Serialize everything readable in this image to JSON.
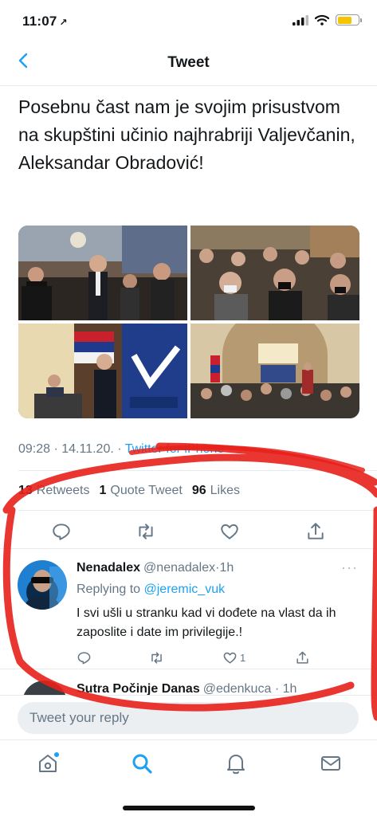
{
  "status_bar": {
    "time": "11:07",
    "location_arrow": "↗"
  },
  "nav": {
    "title": "Tweet",
    "back_icon": "chevron-left-icon"
  },
  "tweet": {
    "text": "Posebnu čast nam je svojim prisustvom na skupštini učinio najhrabriji Valjevčanin, Aleksandar Obradović!",
    "photos": [
      "conference-audience-photo",
      "audience-masks-photo",
      "speaker-podium-photo",
      "hall-audience-photo"
    ],
    "timestamp": "09:28 · 14.11.20.",
    "source_sep": " · ",
    "source": "Twitter for iPhone",
    "stats": {
      "retweets_count": "13",
      "retweets_label": "Retweets",
      "quotes_count": "1",
      "quotes_label": "Quote Tweet",
      "likes_count": "96",
      "likes_label": "Likes"
    }
  },
  "reply": {
    "name": "Nenadalex",
    "handle": "@nenadalex",
    "sep": "·",
    "time": "1h",
    "more": "···",
    "replying_label": "Replying to",
    "replying_handle": "@jeremic_vuk",
    "text": "I svi ušli u stranku kad vi dođete na vlast da ih zaposlite i date im privilegije.!",
    "like_count": "1"
  },
  "next_reply": {
    "name": "Sutra Počinje Danas",
    "handle": "@edenkuca",
    "sep": "·",
    "time": "1h"
  },
  "compose": {
    "placeholder": "Tweet your reply"
  },
  "colors": {
    "accent": "#1da1f2",
    "text": "#14171a",
    "muted": "#657786",
    "annotation": "#e8201a"
  }
}
